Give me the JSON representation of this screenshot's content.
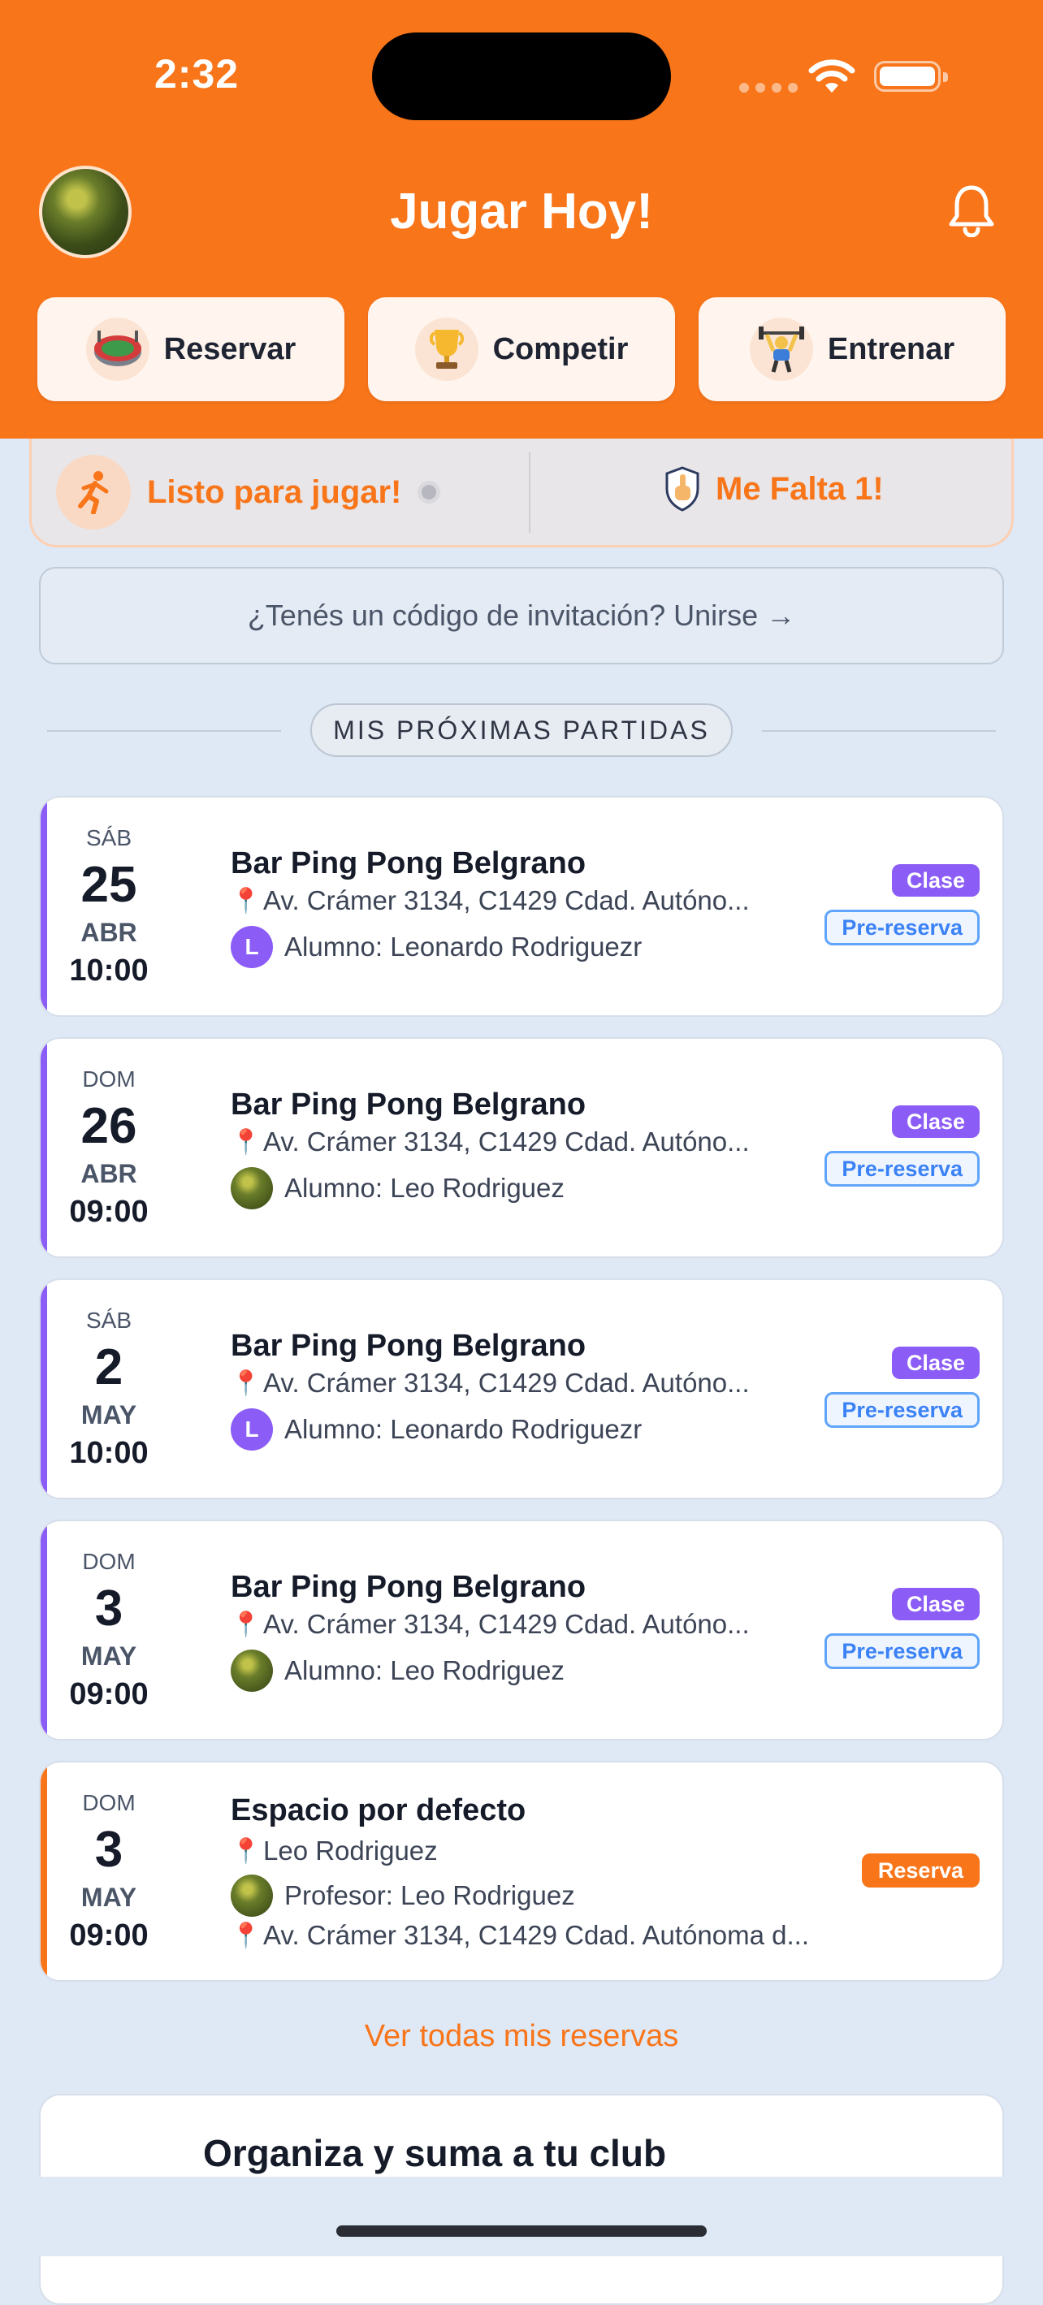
{
  "status_bar": {
    "time": "2:32"
  },
  "header": {
    "title": "Jugar Hoy!",
    "actions": [
      {
        "label": "Reservar",
        "icon": "stadium-icon"
      },
      {
        "label": "Competir",
        "icon": "trophy-icon"
      },
      {
        "label": "Entrenar",
        "icon": "weightlifter-icon"
      }
    ]
  },
  "availability": {
    "ready_label": "Listo para jugar!",
    "falta_label": "Me Falta 1!"
  },
  "invite": {
    "label": "¿Tenés un código de invitación? Unirse →"
  },
  "section": {
    "title": "MIS PRÓXIMAS PARTIDAS"
  },
  "matches": [
    {
      "dow": "SÁB",
      "day": "25",
      "month": "ABR",
      "time": "10:00",
      "title": "Bar Ping Pong Belgrano",
      "address": "Av. Crámer 3134, C1429 Cdad. Autóno...",
      "person": "Alumno: Leonardo Rodriguezr",
      "avatar_letter": "L",
      "badge_type": "Clase",
      "badge_status": "Pre-reserva"
    },
    {
      "dow": "DOM",
      "day": "26",
      "month": "ABR",
      "time": "09:00",
      "title": "Bar Ping Pong Belgrano",
      "address": "Av. Crámer 3134, C1429 Cdad. Autóno...",
      "person": "Alumno: Leo Rodriguez",
      "badge_type": "Clase",
      "badge_status": "Pre-reserva"
    },
    {
      "dow": "SÁB",
      "day": "2",
      "month": "MAY",
      "time": "10:00",
      "title": "Bar Ping Pong Belgrano",
      "address": "Av. Crámer 3134, C1429 Cdad. Autóno...",
      "person": "Alumno: Leonardo Rodriguezr",
      "avatar_letter": "L",
      "badge_type": "Clase",
      "badge_status": "Pre-reserva"
    },
    {
      "dow": "DOM",
      "day": "3",
      "month": "MAY",
      "time": "09:00",
      "title": "Bar Ping Pong Belgrano",
      "address": "Av. Crámer 3134, C1429 Cdad. Autóno...",
      "person": "Alumno: Leo Rodriguez",
      "badge_type": "Clase",
      "badge_status": "Pre-reserva"
    },
    {
      "dow": "DOM",
      "day": "3",
      "month": "MAY",
      "time": "09:00",
      "title": "Espacio por defecto",
      "location": "Leo Rodriguez",
      "person": "Profesor: Leo Rodriguez",
      "address": "Av. Crámer 3134, C1429 Cdad. Autónoma d...",
      "badge_type": "Reserva"
    }
  ],
  "see_all": "Ver todas mis reservas",
  "org_card": {
    "title": "Organiza y suma a tu club"
  },
  "colors": {
    "brand": "#f8751a",
    "clase": "#8b5cf6",
    "pre_reserva": "#3b82f6",
    "background": "#dfe8f5"
  }
}
